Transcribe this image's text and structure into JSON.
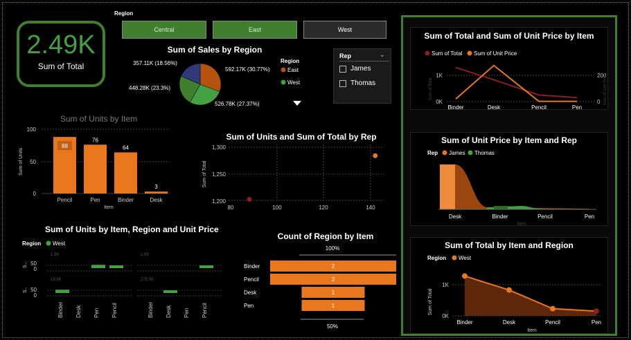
{
  "kpi": {
    "value": "2.49K",
    "label": "Sum of Total"
  },
  "region_slicer": {
    "title": "Region",
    "options": [
      "Central",
      "East",
      "West"
    ],
    "selected": [
      "Central",
      "East"
    ]
  },
  "rep_slicer": {
    "title": "Rep",
    "options": [
      "James",
      "Thomas"
    ]
  },
  "colors": {
    "green": "#43a043",
    "dark_green": "#3f7f2e",
    "orange": "#e8771e",
    "navy": "#2e3a7a",
    "red": "#8a1f22",
    "rust": "#b5520e"
  },
  "pie": {
    "title": "Sum of Sales by Region",
    "legend_title": "Region",
    "legend": [
      "East",
      "West"
    ],
    "labels": [
      "357.11K (18.56%)",
      "592.17K (30.77%)",
      "448.28K (23.3%)",
      "526.78K (27.37%)"
    ]
  },
  "units_by_item": {
    "title": "Sum of Units by Item",
    "ylabel": "Sum of Units",
    "xlabel": "Item",
    "yticks": [
      "100",
      "50",
      "0"
    ]
  },
  "units_total_rep": {
    "title": "Sum of Units and Sum of Total by Rep",
    "ylabel": "Sum of Total",
    "yticks": [
      "1,300",
      "1,250",
      "1,200"
    ],
    "xticks": [
      "80",
      "100",
      "120",
      "140"
    ]
  },
  "small_multiples": {
    "title": "Sum of Units by Item, Region and Unit Price",
    "legend_title": "Region",
    "legend": [
      "West"
    ],
    "panel_labels": [
      "1.99",
      "2.99",
      "19.99",
      "275.00"
    ],
    "yaxis_label": "S..",
    "yticks": [
      "50",
      "0"
    ],
    "items": [
      "Binder",
      "Desk",
      "Pen",
      "Pencil"
    ]
  },
  "funnel": {
    "title": "Count of Region by Item",
    "top_label": "100%",
    "bottom_label": "50%"
  },
  "right": {
    "c1": {
      "title": "Sum of Total and Sum of Unit Price by Item",
      "legend": [
        "Sum of Total",
        "Sum of Unit Price"
      ],
      "yleft": [
        "1K",
        "0K"
      ],
      "yright": [
        "200",
        "0"
      ],
      "yleft_label": "Sum of Total",
      "yright_label": "Sum of Unit Price"
    },
    "c2": {
      "title": "Sum of Unit Price by Item and Rep",
      "legend_title": "Rep",
      "legend": [
        "James",
        "Thomas"
      ],
      "xlabel": "Item"
    },
    "c3": {
      "title": "Sum of Total by Item and Region",
      "legend_title": "Region",
      "legend": [
        "West"
      ],
      "yticks": [
        "1K",
        "0K"
      ],
      "ylabel": "Sum of Total",
      "xlabel": "Item"
    }
  },
  "chart_data": [
    {
      "type": "pie",
      "title": "Sum of Sales by Region",
      "slices": [
        {
          "label": "East",
          "value": 592170,
          "pct": 30.77,
          "color": "#b5520e"
        },
        {
          "label": "",
          "value": 526780,
          "pct": 27.37,
          "color": "#43a043"
        },
        {
          "label": "West",
          "value": 448280,
          "pct": 23.3,
          "color": "#3f7f2e"
        },
        {
          "label": "",
          "value": 357110,
          "pct": 18.56,
          "color": "#2e3a7a"
        }
      ]
    },
    {
      "type": "bar",
      "title": "Sum of Units by Item",
      "categories": [
        "Pencil",
        "Pen",
        "Binder",
        "Desk"
      ],
      "values": [
        88,
        76,
        64,
        3
      ],
      "xlabel": "Item",
      "ylabel": "Sum of Units",
      "ylim": [
        0,
        100
      ]
    },
    {
      "type": "scatter",
      "title": "Sum of Units and Sum of Total by Rep",
      "points": [
        {
          "x": 88,
          "y": 1202
        },
        {
          "x": 142,
          "y": 1284
        }
      ],
      "xlim": [
        80,
        145
      ],
      "ylim": [
        1195,
        1310
      ],
      "ylabel": "Sum of Total"
    },
    {
      "type": "bar",
      "title": "Sum of Units by Item, Region and Unit Price",
      "panels": [
        {
          "label": "1.99",
          "values": [
            0,
            0,
            40,
            20
          ]
        },
        {
          "label": "2.99",
          "values": [
            0,
            0,
            0,
            30
          ]
        },
        {
          "label": "19.99",
          "values": [
            40,
            0,
            0,
            0
          ]
        },
        {
          "label": "275.00",
          "values": [
            0,
            3,
            0,
            0
          ]
        }
      ],
      "categories": [
        "Binder",
        "Desk",
        "Pen",
        "Pencil"
      ]
    },
    {
      "type": "bar",
      "title": "Count of Region by Item",
      "categories": [
        "Binder",
        "Pencil",
        "Desk",
        "Pen"
      ],
      "values": [
        2,
        2,
        1,
        1
      ]
    },
    {
      "type": "line",
      "title": "Sum of Total and Sum of Unit Price by Item",
      "categories": [
        "Binder",
        "Desk",
        "Pencil",
        "Pen"
      ],
      "series": [
        {
          "name": "Sum of Total",
          "values": [
            1300,
            830,
            250,
            150
          ]
        },
        {
          "name": "Sum of Unit Price",
          "values": [
            20,
            275,
            2,
            2
          ]
        }
      ]
    },
    {
      "type": "area",
      "title": "Sum of Unit Price by Item and Rep",
      "categories": [
        "Desk",
        "Binder",
        "Pencil",
        "Pen"
      ],
      "series": [
        {
          "name": "James",
          "values": [
            275,
            10,
            2,
            2
          ]
        },
        {
          "name": "Thomas",
          "values": [
            0,
            20,
            2,
            2
          ]
        }
      ]
    },
    {
      "type": "area",
      "title": "Sum of Total by Item and Region",
      "categories": [
        "Binder",
        "Desk",
        "Pencil",
        "Pen"
      ],
      "series": [
        {
          "name": "West",
          "values": [
            1280,
            830,
            230,
            150
          ]
        }
      ]
    }
  ]
}
